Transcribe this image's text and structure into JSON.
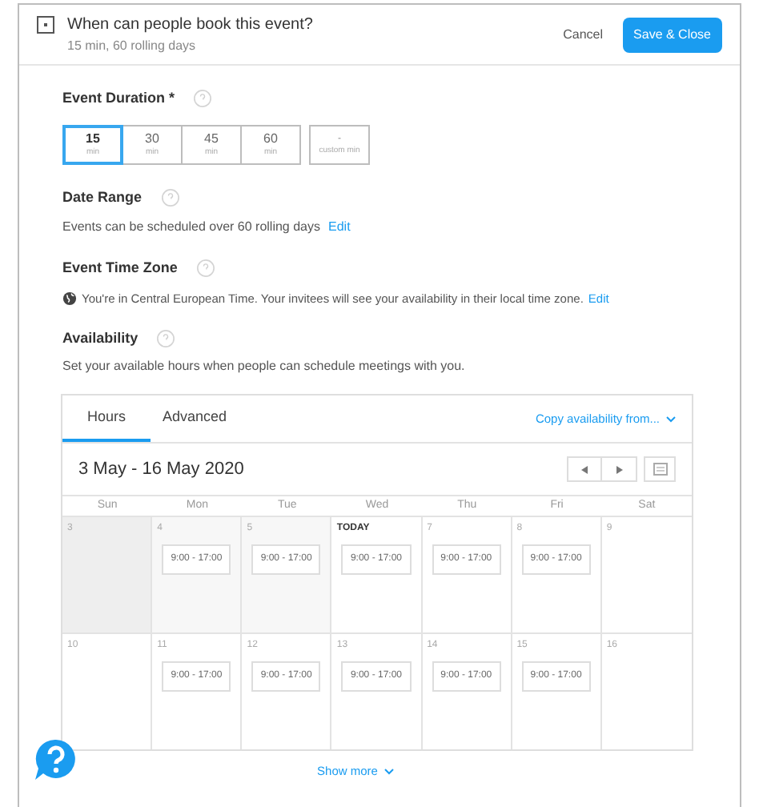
{
  "header": {
    "title": "When can people book this event?",
    "subtitle": "15 min, 60 rolling days",
    "cancel": "Cancel",
    "save": "Save & Close"
  },
  "duration": {
    "label": "Event Duration *",
    "options": [
      {
        "value": "15",
        "unit": "min",
        "selected": true
      },
      {
        "value": "30",
        "unit": "min",
        "selected": false
      },
      {
        "value": "45",
        "unit": "min",
        "selected": false
      },
      {
        "value": "60",
        "unit": "min",
        "selected": false
      }
    ],
    "custom": {
      "placeholder": "-",
      "unit": "custom min"
    }
  },
  "date_range": {
    "label": "Date Range",
    "text": "Events can be scheduled over 60 rolling days",
    "link": "Edit"
  },
  "time_zone": {
    "label": "Event Time Zone",
    "text": "You're in Central European Time. Your invitees will see your availability in their local time zone.",
    "link": "Edit"
  },
  "availability": {
    "label": "Availability",
    "text": "Set your available hours when people can schedule meetings with you."
  },
  "calendar": {
    "tabs": [
      {
        "label": "Hours",
        "selected": true
      },
      {
        "label": "Advanced",
        "selected": false
      }
    ],
    "copy_link": "Copy availability from...",
    "range": "3 May - 16 May 2020",
    "weekdays": [
      "Sun",
      "Mon",
      "Tue",
      "Wed",
      "Thu",
      "Fri",
      "Sat"
    ],
    "weeks": [
      [
        {
          "day": "3",
          "kind": "past"
        },
        {
          "day": "4",
          "kind": "past",
          "intervals": [
            "9:00 - 17:00"
          ]
        },
        {
          "day": "5",
          "kind": "past",
          "intervals": [
            "9:00 - 17:00"
          ]
        },
        {
          "day": "TODAY",
          "kind": "today",
          "intervals": [
            "9:00 - 17:00"
          ]
        },
        {
          "day": "7",
          "kind": "future",
          "intervals": [
            "9:00 - 17:00"
          ]
        },
        {
          "day": "8",
          "kind": "future",
          "intervals": [
            "9:00 - 17:00"
          ]
        },
        {
          "day": "9",
          "kind": "future"
        }
      ],
      [
        {
          "day": "10",
          "kind": "future"
        },
        {
          "day": "11",
          "kind": "future",
          "intervals": [
            "9:00 - 17:00"
          ]
        },
        {
          "day": "12",
          "kind": "future",
          "intervals": [
            "9:00 - 17:00"
          ]
        },
        {
          "day": "13",
          "kind": "future",
          "intervals": [
            "9:00 - 17:00"
          ]
        },
        {
          "day": "14",
          "kind": "future",
          "intervals": [
            "9:00 - 17:00"
          ]
        },
        {
          "day": "15",
          "kind": "future",
          "intervals": [
            "9:00 - 17:00"
          ]
        },
        {
          "day": "16",
          "kind": "future"
        }
      ]
    ],
    "show_more": "Show more"
  }
}
